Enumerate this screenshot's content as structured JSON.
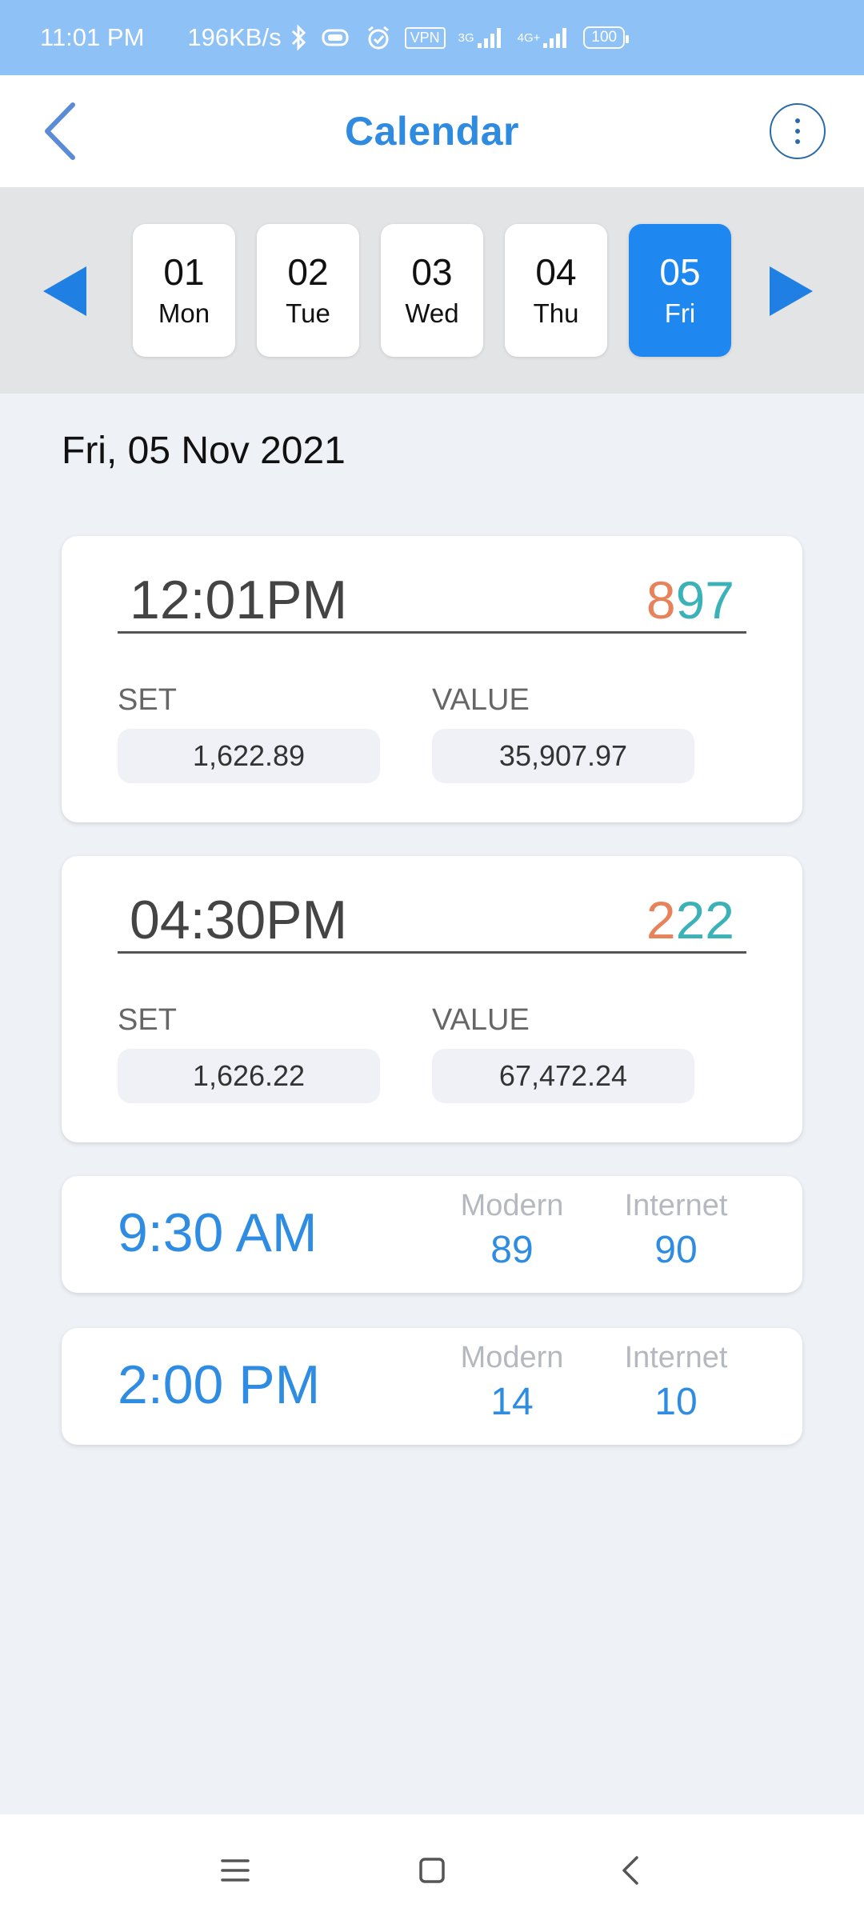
{
  "status_bar": {
    "time": "11:01 PM",
    "net_speed": "196KB/s",
    "vpn": "VPN",
    "net1": "3G",
    "net2": "4G+",
    "battery": "100"
  },
  "header": {
    "title": "Calendar",
    "back_icon": "back-arrow-icon",
    "more_icon": "more-vertical-icon",
    "accent_color": "#2F8BDF"
  },
  "date_strip": {
    "days": [
      {
        "num": "01",
        "dow": "Mon",
        "selected": false
      },
      {
        "num": "02",
        "dow": "Tue",
        "selected": false
      },
      {
        "num": "03",
        "dow": "Wed",
        "selected": false
      },
      {
        "num": "04",
        "dow": "Thu",
        "selected": false
      },
      {
        "num": "05",
        "dow": "Fri",
        "selected": true
      }
    ],
    "selected_color": "#1E88F0"
  },
  "selected_date": "Fri, 05 Nov 2021",
  "result_cards": [
    {
      "time": "12:01PM",
      "result_first": "8",
      "result_rest": "97",
      "set_label": "SET",
      "set_value": "1,622.89",
      "value_label": "VALUE",
      "value_value": "35,907.97"
    },
    {
      "time": "04:30PM",
      "result_first": "2",
      "result_rest": "22",
      "set_label": "SET",
      "set_value": "1,626.22",
      "value_label": "VALUE",
      "value_value": "67,472.24"
    }
  ],
  "session_cards": [
    {
      "time": "9:30 AM",
      "modern_label": "Modern",
      "modern_value": "89",
      "internet_label": "Internet",
      "internet_value": "90"
    },
    {
      "time": "2:00 PM",
      "modern_label": "Modern",
      "modern_value": "14",
      "internet_label": "Internet",
      "internet_value": "10"
    }
  ],
  "colors": {
    "result_first": "#E8825A",
    "result_rest": "#3BB1B8",
    "session_blue": "#2E8CE2"
  }
}
